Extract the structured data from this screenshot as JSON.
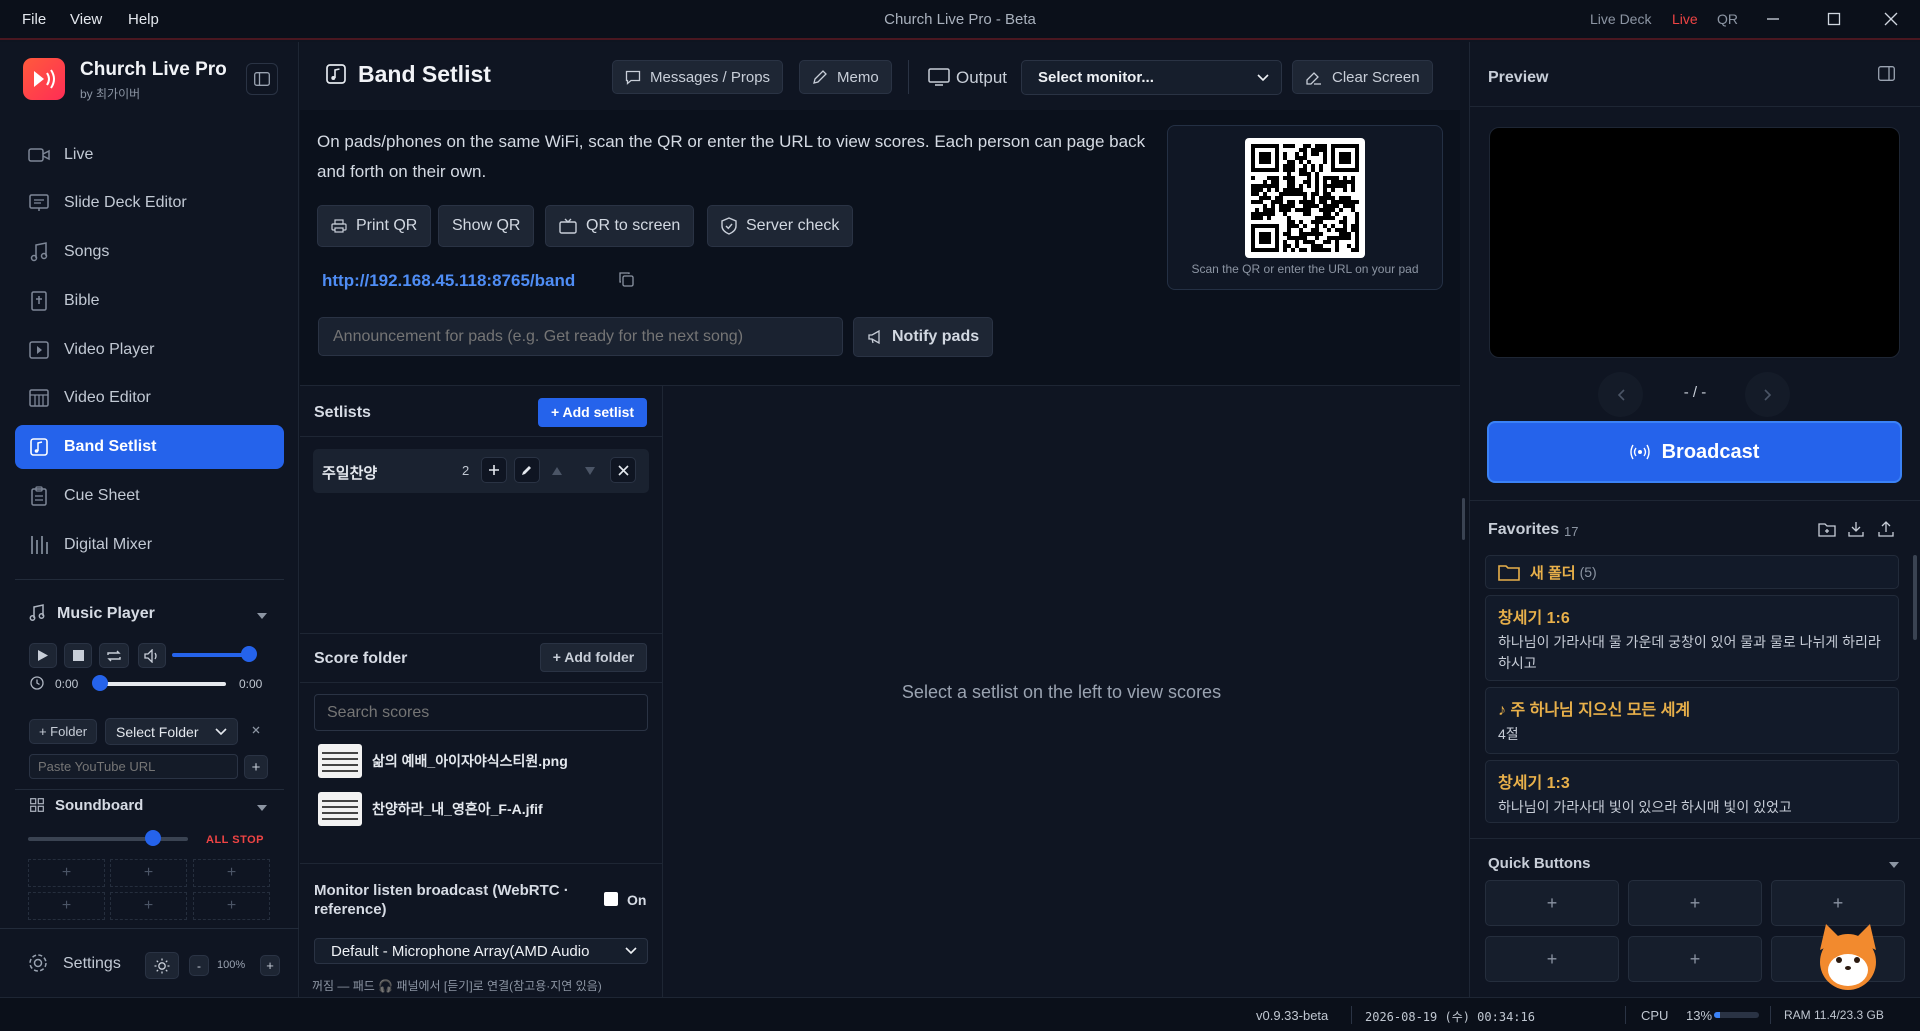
{
  "titlebar": {
    "menus": [
      "File",
      "View",
      "Help"
    ],
    "title": "Church Live Pro - Beta",
    "live_deck": "Live Deck",
    "live": "Live",
    "qr": "QR"
  },
  "brand": {
    "name": "Church Live Pro",
    "by": "by 최가이버",
    "accent": "#2563eb"
  },
  "nav": [
    {
      "label": "Live",
      "icon": "camera-icon"
    },
    {
      "label": "Slide Deck Editor",
      "icon": "slides-icon"
    },
    {
      "label": "Songs",
      "icon": "music-note-icon"
    },
    {
      "label": "Bible",
      "icon": "bible-icon"
    },
    {
      "label": "Video Player",
      "icon": "play-icon"
    },
    {
      "label": "Video Editor",
      "icon": "film-icon"
    },
    {
      "label": "Band Setlist",
      "icon": "band-icon",
      "active": true
    },
    {
      "label": "Cue Sheet",
      "icon": "clipboard-icon"
    },
    {
      "label": "Digital Mixer",
      "icon": "mixer-icon"
    }
  ],
  "music_player": {
    "title": "Music Player",
    "time_current": "0:00",
    "time_total": "0:00",
    "volume": 0.8,
    "progress": 0.0,
    "folder_btn": "+ Folder",
    "select_folder": "Select Folder",
    "youtube_placeholder": "Paste YouTube URL",
    "add": "+"
  },
  "soundboard": {
    "title": "Soundboard",
    "all_stop": "ALL STOP",
    "level": 0.78,
    "cell": "+"
  },
  "settings": {
    "label": "Settings",
    "minus": "-",
    "zoom": "100%",
    "plus": "+"
  },
  "page": {
    "title": "Band Setlist",
    "messages_btn": "Messages / Props",
    "memo_btn": "Memo",
    "output_label": "Output",
    "monitor_select": "Select monitor...",
    "clear_btn": "Clear Screen",
    "info_text": "On pads/phones on the same WiFi, scan the QR or enter the URL to view scores. Each person can page back and forth on their own.",
    "print_qr": "Print QR",
    "show_qr": "Show QR",
    "qr_to_screen": "QR to screen",
    "server_check": "Server check",
    "url": "http://192.168.45.118:8765/band",
    "qr_caption": "Scan the QR or enter the URL on your pad",
    "announce_placeholder": "Announcement for pads (e.g. Get ready for the next song)",
    "notify_btn": "Notify pads"
  },
  "setlists": {
    "title": "Setlists",
    "add_btn": "+ Add setlist",
    "items": [
      {
        "name": "주일찬양",
        "count": "2"
      }
    ]
  },
  "score_folder": {
    "title": "Score folder",
    "add_btn": "+ Add folder",
    "search_placeholder": "Search scores",
    "files": [
      "삶의 예배_아이자야식스티원.png",
      "찬양하라_내_영혼아_F-A.jfif"
    ]
  },
  "monitor": {
    "title": "Monitor listen broadcast (WebRTC · reference)",
    "on_label": "On",
    "device": "Default - Microphone Array(AMD Audio",
    "note": "꺼짐 — 패드 🎧 패널에서 [듣기]로 연결(참고용·지연 있음)"
  },
  "viewer_empty": "Select a setlist on the left to view scores",
  "preview": {
    "title": "Preview",
    "page": "- / -",
    "broadcast": "Broadcast"
  },
  "favorites": {
    "title": "Favorites",
    "count": "17",
    "folder": {
      "name": "새 폴더",
      "count": "(5)"
    },
    "items": [
      {
        "title": "창세기 1:6",
        "body": "하나님이 가라사대 물 가운데 궁창이 있어 물과 물로 나뉘게 하리라 하시고"
      },
      {
        "title": "♪ 주 하나님 지으신 모든 세계",
        "body": "4절"
      },
      {
        "title": "창세기 1:3",
        "body": "하나님이 가라사대 빛이 있으라 하시매 빛이 있었고"
      }
    ]
  },
  "quick_buttons": {
    "title": "Quick Buttons",
    "cell": "+"
  },
  "status": {
    "version": "v0.9.33-beta",
    "datetime": "2026-08-19 (수) 00:34:16",
    "cpu_label": "CPU",
    "cpu_value": "13%",
    "cpu_level": 0.13,
    "ram": "RAM 11.4/23.3 GB"
  }
}
